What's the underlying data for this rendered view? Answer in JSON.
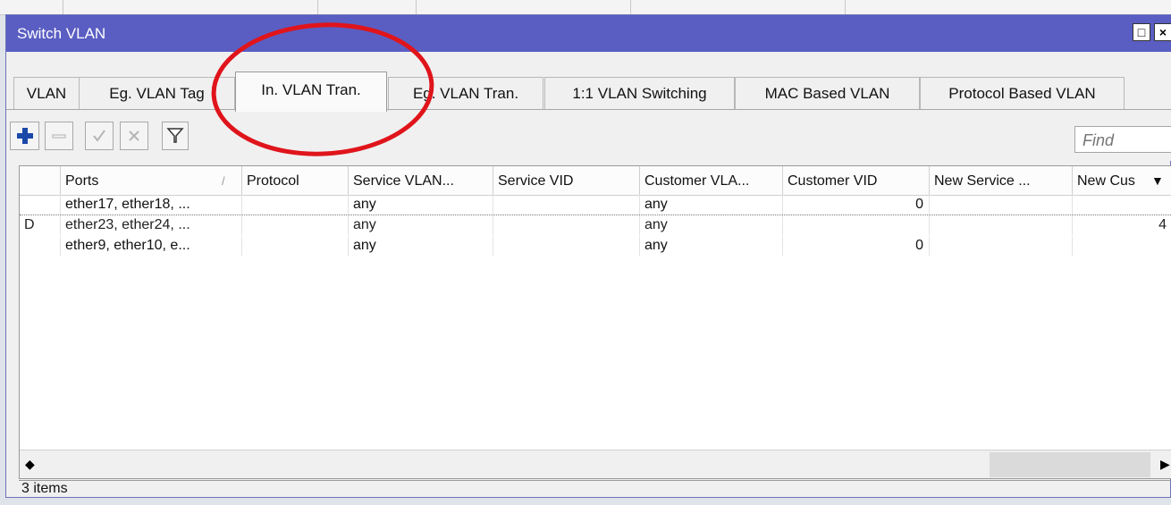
{
  "window": {
    "title": "Switch VLAN",
    "restore_glyph": "□",
    "close_glyph": "×"
  },
  "tabs": [
    {
      "label": "VLAN"
    },
    {
      "label": "Eg. VLAN Tag"
    },
    {
      "label": "In. VLAN Tran.",
      "active": true
    },
    {
      "label": "Eg. VLAN Tran."
    },
    {
      "label": "1:1 VLAN Switching"
    },
    {
      "label": "MAC Based VLAN"
    },
    {
      "label": "Protocol Based VLAN"
    }
  ],
  "toolbar": {
    "find_placeholder": "Find",
    "icons": [
      "add-icon",
      "remove-icon",
      "enable-icon",
      "disable-icon",
      "filter-icon"
    ]
  },
  "table": {
    "columns": [
      "",
      "Ports",
      "Protocol",
      "Service VLAN...",
      "Service VID",
      "Customer VLA...",
      "Customer VID",
      "New Service ...",
      "New Cus"
    ],
    "sort_indicator": "/",
    "rows": [
      {
        "flag": "",
        "ports": "ether17, ether18, ...",
        "protocol": "",
        "service_vlan": "any",
        "service_vid": "",
        "customer_vlan": "any",
        "customer_vid": "0",
        "new_service": "",
        "new_customer": ""
      },
      {
        "flag": "D",
        "ports": "ether23, ether24, ...",
        "protocol": "",
        "service_vlan": "any",
        "service_vid": "",
        "customer_vlan": "any",
        "customer_vid": "",
        "new_service": "",
        "new_customer": "4"
      },
      {
        "flag": "",
        "ports": "ether9, ether10, e...",
        "protocol": "",
        "service_vlan": "any",
        "service_vid": "",
        "customer_vlan": "any",
        "customer_vid": "0",
        "new_service": "",
        "new_customer": ""
      }
    ]
  },
  "status": {
    "text": "3 items"
  },
  "colors": {
    "titlebar": "#5a5ec2",
    "annotation": "#e0141b",
    "add_icon": "#1b47a8"
  }
}
